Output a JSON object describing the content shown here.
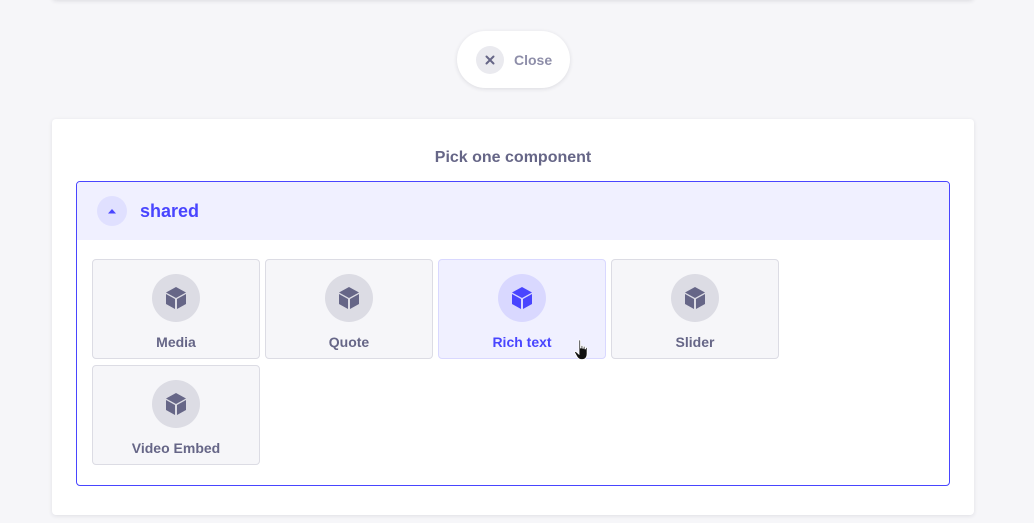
{
  "close_button": {
    "label": "Close"
  },
  "picker": {
    "title": "Pick one component",
    "group": {
      "name": "shared",
      "expanded": true,
      "components": [
        {
          "label": "Media",
          "icon": "cube-icon",
          "state": "default"
        },
        {
          "label": "Quote",
          "icon": "cube-icon",
          "state": "default"
        },
        {
          "label": "Rich text",
          "icon": "cube-icon",
          "state": "hover"
        },
        {
          "label": "Slider",
          "icon": "cube-icon",
          "state": "default"
        },
        {
          "label": "Video Embed",
          "icon": "cube-icon",
          "state": "default"
        }
      ]
    }
  },
  "colors": {
    "accent": "#4945ff",
    "accent_light": "#f0f0ff",
    "text_muted": "#666687",
    "background": "#f6f6f9"
  }
}
